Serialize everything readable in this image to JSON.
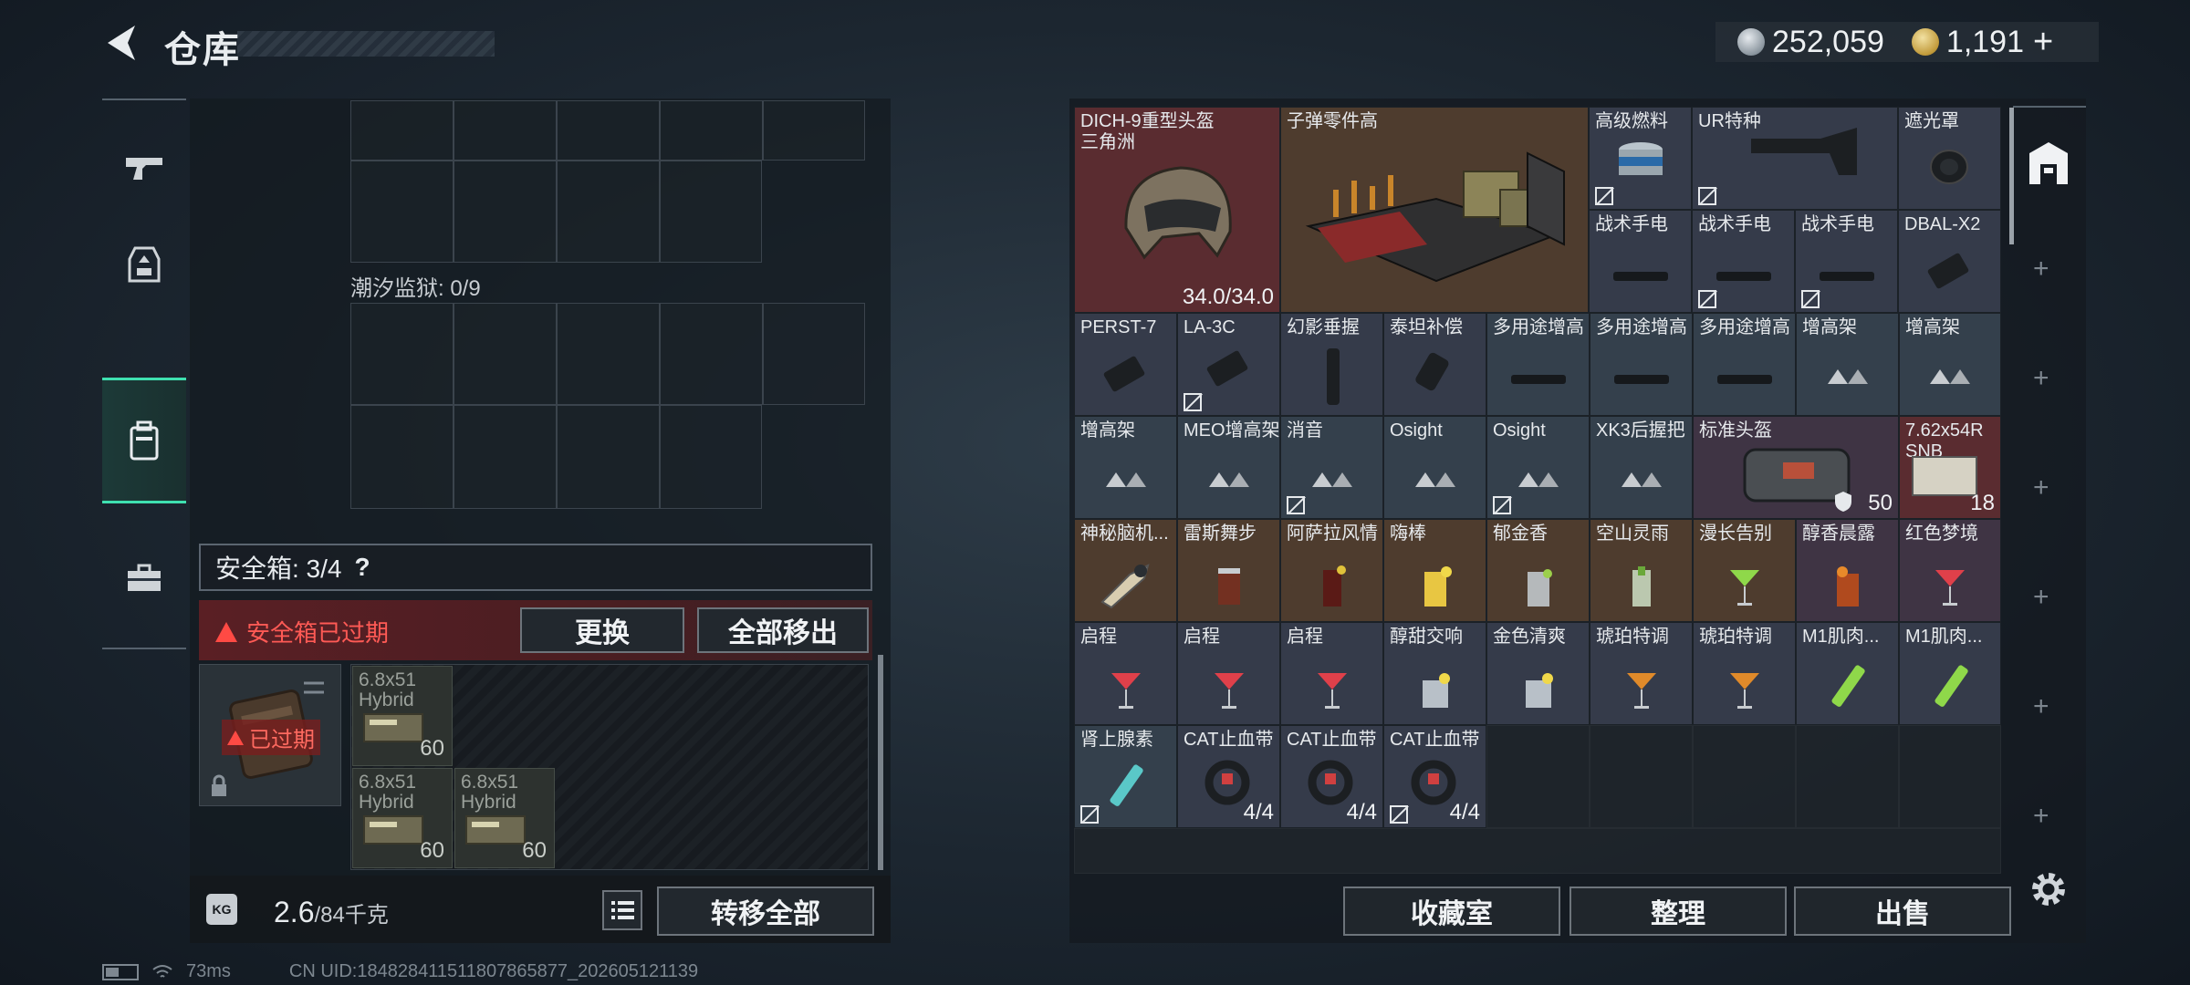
{
  "header": {
    "title": "仓库",
    "silver_value": "252,059",
    "gold_value": "1,191",
    "gold_plus": "+"
  },
  "left": {
    "prison_label": "潮汐监狱: 0/9",
    "safe_box_label": "安全箱: 3/4",
    "safe_box_help": "?",
    "expired_notice": "安全箱已过期",
    "replace_button": "更换",
    "remove_all_button": "全部移出",
    "case_expired_tag": "已过期",
    "ammo": [
      {
        "name_line1": "6.8x51",
        "name_line2": "Hybrid",
        "count": "60"
      },
      {
        "name_line1": "6.8x51",
        "name_line2": "Hybrid",
        "count": "60"
      },
      {
        "name_line1": "6.8x51",
        "name_line2": "Hybrid",
        "count": "60"
      }
    ],
    "weight_value": "2.6",
    "weight_unit": "/84千克",
    "kg_label": "KG",
    "transfer_all_button": "转移全部"
  },
  "inventory": {
    "row1": {
      "helmet": {
        "name_line1": "DICH-9重型头盔",
        "name_line2": "三角洲",
        "durability": "34.0/34.0"
      },
      "parts": {
        "name": "子弹零件高"
      },
      "fuel": {
        "name": "高级燃料"
      },
      "ur_stock": {
        "name": "UR特种"
      },
      "shade": {
        "name": "遮光罩"
      },
      "flashlight1": {
        "name": "战术手电"
      },
      "flashlight2": {
        "name": "战术手电"
      },
      "flashlight3": {
        "name": "战术手电"
      },
      "dbal": {
        "name": "DBAL-X2"
      }
    },
    "row3": [
      "PERST-7",
      "LA-3C",
      "幻影垂握",
      "泰坦补偿",
      "多用途增高",
      "多用途增高",
      "多用途增高",
      "增高架",
      "增高架"
    ],
    "row4": {
      "items": [
        "增高架",
        "MEO增高架",
        "消音",
        "Osight",
        "Osight",
        "XK3后握把"
      ],
      "standard_helmet": {
        "name": "标准头盔",
        "durability": "50"
      },
      "ammo": {
        "name_line1": "7.62x54R",
        "name_line2": "SNB",
        "count": "18"
      }
    },
    "row5": [
      "神秘脑机...",
      "雷斯舞步",
      "阿萨拉风情",
      "嗨棒",
      "郁金香",
      "空山灵雨",
      "漫长告别",
      "醇香晨露",
      "红色梦境"
    ],
    "row6": [
      "启程",
      "启程",
      "启程",
      "醇甜交响",
      "金色清爽",
      "琥珀特调",
      "琥珀特调",
      "M1肌肉...",
      "M1肌肉..."
    ],
    "row7": [
      {
        "name": "肾上腺素",
        "count": ""
      },
      {
        "name": "CAT止血带",
        "count": "4/4"
      },
      {
        "name": "CAT止血带",
        "count": "4/4"
      },
      {
        "name": "CAT止血带",
        "count": "4/4"
      }
    ]
  },
  "bottom_buttons": {
    "collection": "收藏室",
    "organize": "整理",
    "sell": "出售"
  },
  "status": {
    "ping": "73ms",
    "uid": "CN UID:18482841151180786587​7_202605121139"
  },
  "colors": {
    "accent": "#3fe0b0",
    "warning": "#ff5a55"
  }
}
